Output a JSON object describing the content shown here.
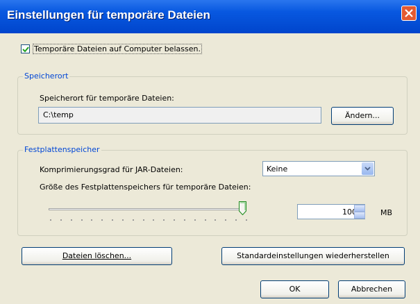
{
  "window": {
    "title": "Einstellungen für temporäre Dateien"
  },
  "keep_files": {
    "label": "Temporäre Dateien auf Computer belassen.",
    "checked": true
  },
  "location": {
    "group_title": "Speicherort",
    "field_label": "Speicherort für temporäre Dateien:",
    "path": "C:\\temp",
    "change_button": "Ändern..."
  },
  "disk": {
    "group_title": "Festplattenspeicher",
    "compression_label": "Komprimierungsgrad für JAR-Dateien:",
    "compression_value": "Keine",
    "size_label": "Größe des Festplattenspeichers für temporäre Dateien:",
    "size_value": "1000",
    "size_unit": "MB",
    "slider_level": 1.0
  },
  "actions": {
    "delete_button": "Dateien löschen...",
    "restore_button": "Standardeinstellungen wiederherstellen",
    "ok_button": "OK",
    "cancel_button": "Abbrechen"
  },
  "colors": {
    "titlebar": "#0858e0",
    "group_title": "#0046d5",
    "close_button": "#e45a31"
  }
}
